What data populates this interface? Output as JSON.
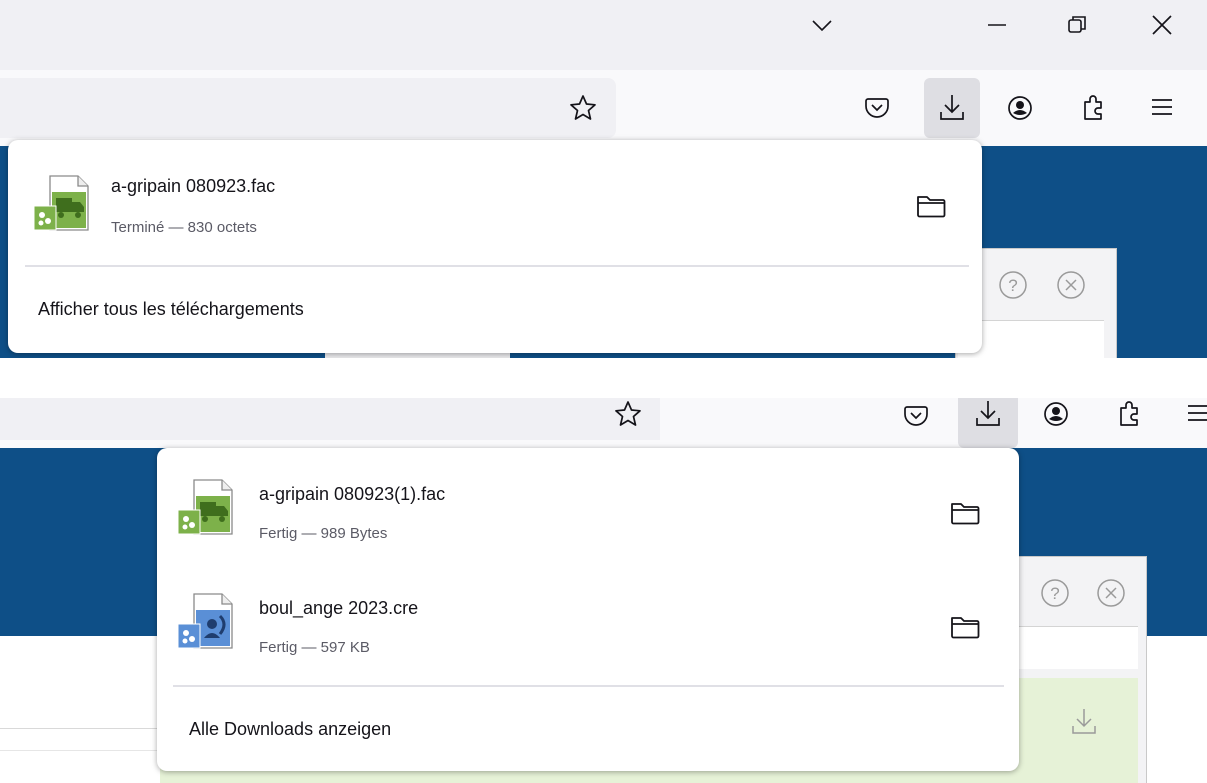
{
  "panel_fr": {
    "download": {
      "filename": "a-gripain 080923.fac",
      "status": "Terminé — 830 octets",
      "file_icon": "green-truck-file-icon",
      "folder_icon": "folder-icon"
    },
    "show_all_label": "Afficher tous les téléchargements"
  },
  "panel_de": {
    "downloads": [
      {
        "filename": "a-gripain 080923(1).fac",
        "status": "Fertig — 989 Bytes",
        "file_icon": "green-truck-file-icon",
        "folder_icon": "folder-icon"
      },
      {
        "filename": "boul_ange 2023.cre",
        "status": "Fertig — 597 KB",
        "file_icon": "blue-user-file-icon",
        "folder_icon": "folder-icon"
      }
    ],
    "show_all_label": "Alle Downloads anzeigen"
  },
  "toolbar_icons": [
    "bookmark-star-icon",
    "pocket-icon",
    "downloads-icon",
    "account-icon",
    "extensions-icon",
    "menu-icon"
  ],
  "window_icons": [
    "tab-list-chevron-icon",
    "minimize-icon",
    "restore-icon",
    "close-icon"
  ],
  "colors": {
    "content_blue": "#0e4f87",
    "popup_bg": "#ffffff",
    "text": "#15141a",
    "subtext": "#5b5b66",
    "green_file": "#7db14a",
    "blue_file": "#5a8fd6"
  }
}
